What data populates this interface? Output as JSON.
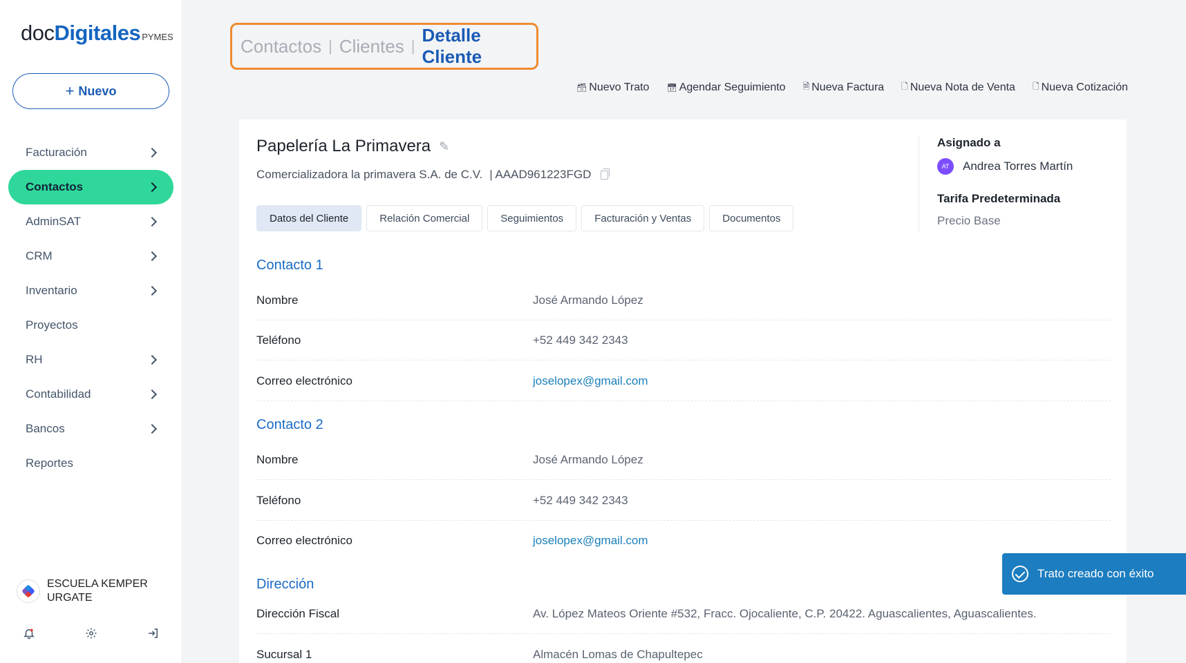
{
  "logo": {
    "part1": "doc",
    "part2": "Digitales",
    "part3": "PYMES"
  },
  "new_button": {
    "plus": "+",
    "label": "Nuevo"
  },
  "sidebar": {
    "items": [
      {
        "label": "Facturación",
        "chevron": true
      },
      {
        "label": "Contactos",
        "chevron": true,
        "active": true
      },
      {
        "label": "AdminSAT",
        "chevron": true
      },
      {
        "label": "CRM",
        "chevron": true
      },
      {
        "label": "Inventario",
        "chevron": true
      },
      {
        "label": "Proyectos",
        "chevron": false
      },
      {
        "label": "RH",
        "chevron": true
      },
      {
        "label": "Contabilidad",
        "chevron": true
      },
      {
        "label": "Bancos",
        "chevron": true
      },
      {
        "label": "Reportes",
        "chevron": false
      }
    ],
    "org": {
      "line1": "ESCUELA KEMPER",
      "line2": "URGATE"
    },
    "footer_icons": [
      "bell-icon",
      "gear-icon",
      "logout-icon"
    ]
  },
  "breadcrumb": {
    "item1": "Contactos",
    "item2": "Clientes",
    "current": "Detalle Cliente",
    "separator": "|"
  },
  "actions": [
    {
      "label": "Nuevo Trato",
      "icon": "briefcase-icon"
    },
    {
      "label": "Agendar Seguimiento",
      "icon": "calendar-icon"
    },
    {
      "label": "Nueva Factura",
      "icon": "invoice-icon"
    },
    {
      "label": "Nueva Nota de Venta",
      "icon": "note-icon"
    },
    {
      "label": "Nueva Cotización",
      "icon": "document-icon"
    }
  ],
  "client": {
    "name": "Papelería La Primavera",
    "legal_name": "Comercializadora la primavera S.A. de C.V.",
    "rfc": "| AAAD961223FGD"
  },
  "tabs": [
    {
      "label": "Datos del Cliente",
      "active": true
    },
    {
      "label": "Relación Comercial"
    },
    {
      "label": "Seguimientos"
    },
    {
      "label": "Facturación y Ventas"
    },
    {
      "label": "Documentos"
    }
  ],
  "side_info": {
    "assigned_label": "Asignado a",
    "assignee_initials": "AT",
    "assignee_name": "Andrea Torres Martín",
    "rate_label": "Tarifa Predeterminada",
    "rate_value": "Precio Base"
  },
  "sections": {
    "contact1": {
      "title": "Contacto 1",
      "name_label": "Nombre",
      "name": "José Armando López",
      "phone_label": "Teléfono",
      "phone": "+52 449 342 2343",
      "email_label": "Correo electrónico",
      "email": "joselopex@gmail.com"
    },
    "contact2": {
      "title": "Contacto 2",
      "name_label": "Nombre",
      "name": "José Armando López",
      "phone_label": "Teléfono",
      "phone": "+52 449 342 2343",
      "email_label": "Correo electrónico",
      "email": "joselopex@gmail.com"
    },
    "address": {
      "title": "Dirección",
      "fiscal_label": "Dirección Fiscal",
      "fiscal": "Av. López Mateos Oriente #532, Fracc. Ojocaliente, C.P. 20422. Aguascalientes, Aguascalientes.",
      "branch_label": "Sucursal 1",
      "branch": "Almacén Lomas de Chapultepec"
    }
  },
  "toast": {
    "message": "Trato creado con éxito"
  },
  "colors": {
    "accent": "#2fd89a",
    "brand": "#1a5bb5",
    "highlight": "#ef8a2e",
    "toast": "#1c7dc0"
  }
}
